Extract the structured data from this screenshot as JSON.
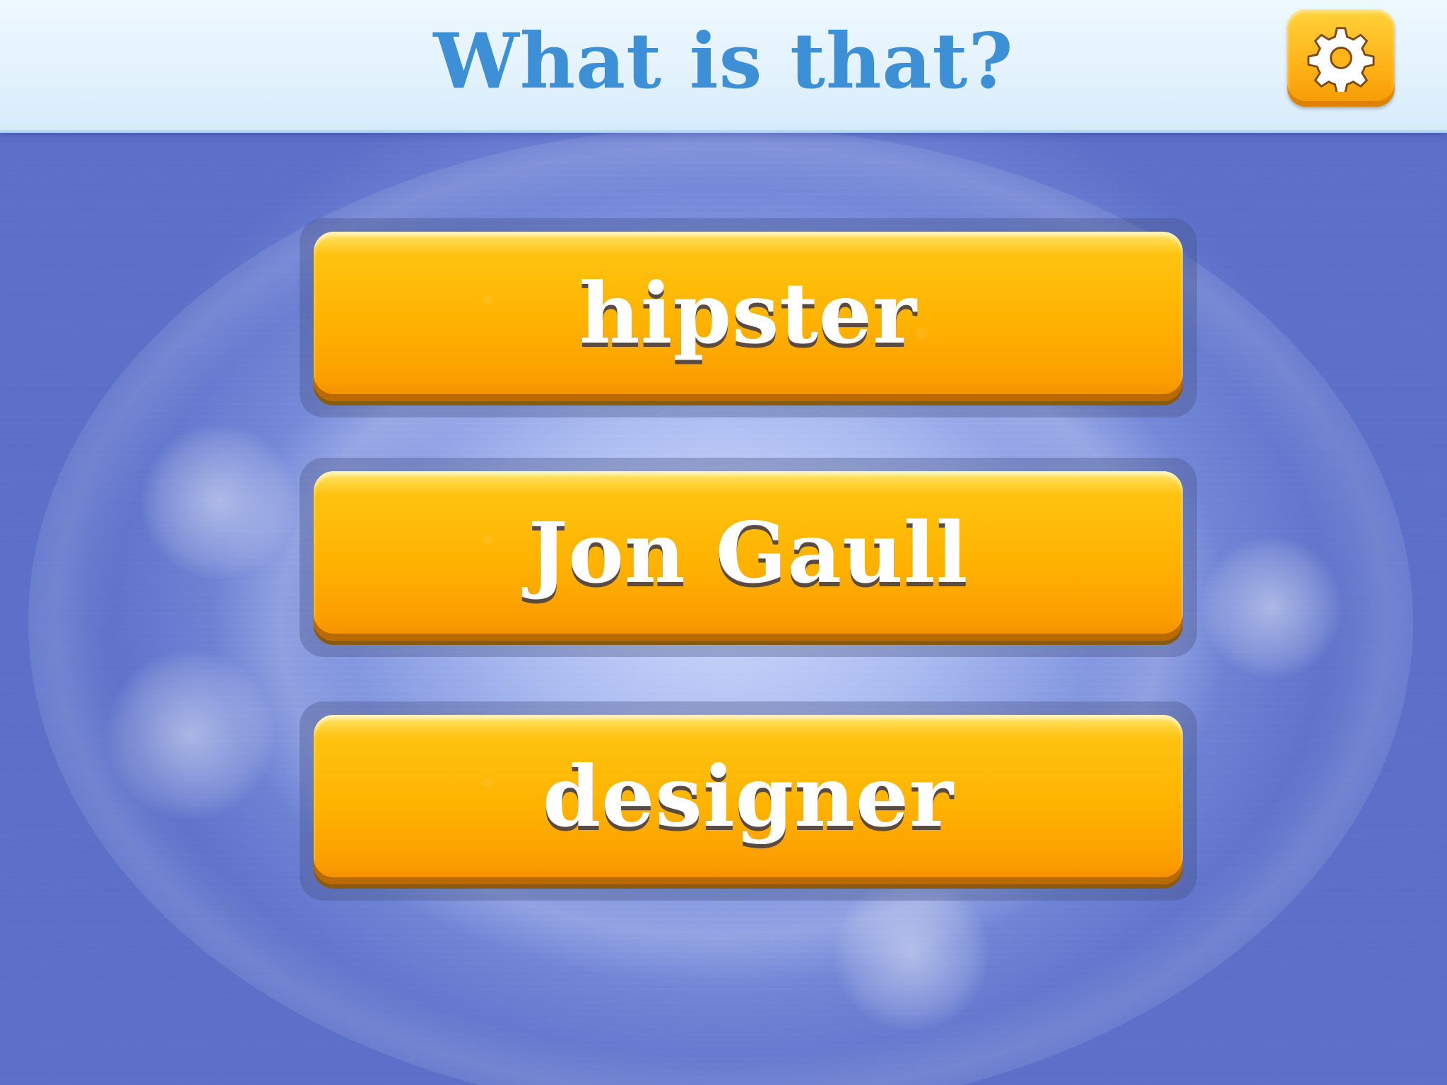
{
  "header": {
    "title": "What is that?",
    "settings_icon": "gear-icon"
  },
  "answers": [
    {
      "label": "hipster"
    },
    {
      "label": "Jon Gaull"
    },
    {
      "label": "designer"
    }
  ],
  "colors": {
    "title_blue": "#3d8fd6",
    "button_orange": "#ffb200",
    "background_blue": "#6f86d6"
  }
}
